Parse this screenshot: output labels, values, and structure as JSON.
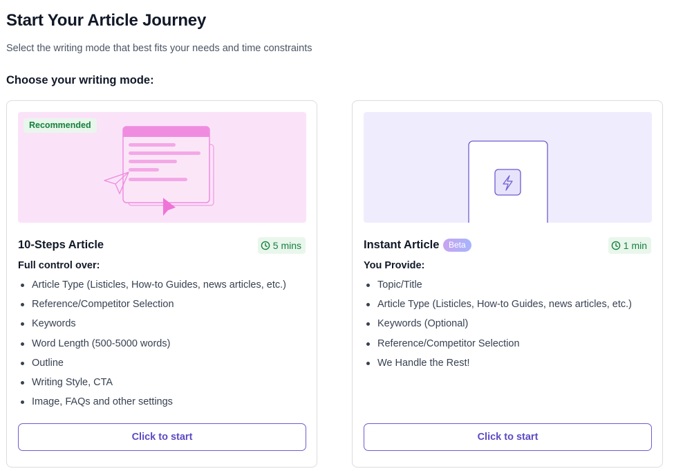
{
  "header": {
    "title": "Start Your Article Journey",
    "subtitle": "Select the writing mode that best fits your needs and time constraints"
  },
  "section_label": "Choose your writing mode:",
  "cards": [
    {
      "badge": "Recommended",
      "title": "10-Steps Article",
      "time": "5 mins",
      "list_heading": "Full control over:",
      "items": [
        "Article Type (Listicles, How-to Guides, news articles, etc.)",
        "Reference/Competitor Selection",
        "Keywords",
        "Word Length (500-5000 words)",
        "Outline",
        "Writing Style, CTA",
        "Image, FAQs and other settings"
      ],
      "button_label": "Click to start",
      "illustration_bg": "#fae3f8",
      "accent": "#ef8ce0"
    },
    {
      "title": "Instant Article",
      "beta": "Beta",
      "time": "1 min",
      "list_heading": "You Provide:",
      "items": [
        "Topic/Title",
        "Article Type (Listicles, How-to Guides, news articles, etc.)",
        "Keywords (Optional)",
        "Reference/Competitor Selection",
        "We Handle the Rest!"
      ],
      "button_label": "Click to start",
      "illustration_bg": "#efedfd",
      "accent": "#6d5bd0"
    }
  ],
  "icons": {
    "time": "clock-icon",
    "instant": "lightning-icon",
    "pointer": "cursor-arrow-icon",
    "send": "paper-plane-icon"
  },
  "colors": {
    "badge_green_bg": "#e9f6ec",
    "badge_green_text": "#15803d",
    "button_border": "#6d5bd0"
  }
}
